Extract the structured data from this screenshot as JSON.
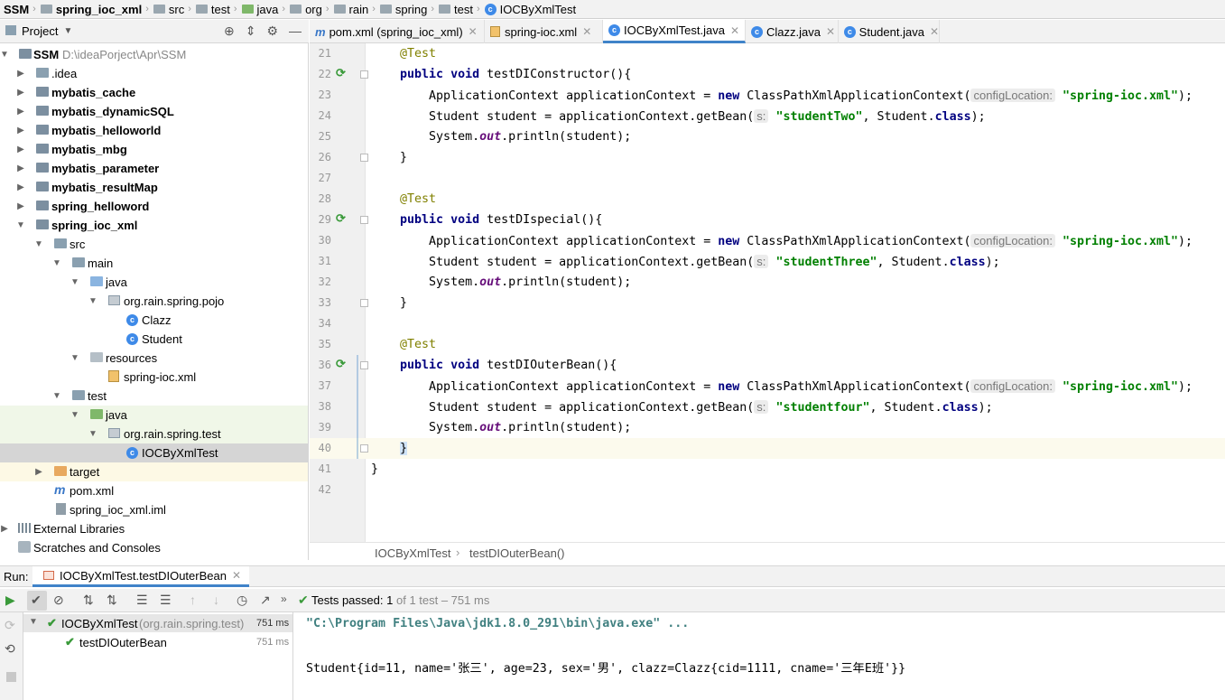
{
  "breadcrumb": [
    "SSM",
    "spring_ioc_xml",
    "src",
    "test",
    "java",
    "org",
    "rain",
    "spring",
    "test",
    "IOCByXmlTest"
  ],
  "project_panel": {
    "title": "Project",
    "tree": [
      {
        "label": "SSM",
        "extra": "D:\\ideaPorject\\Apr\\SSM",
        "bold": true
      },
      {
        "label": ".idea"
      },
      {
        "label": "mybatis_cache",
        "bold": true
      },
      {
        "label": "mybatis_dynamicSQL",
        "bold": true
      },
      {
        "label": "mybatis_helloworld",
        "bold": true
      },
      {
        "label": "mybatis_mbg",
        "bold": true
      },
      {
        "label": "mybatis_parameter",
        "bold": true
      },
      {
        "label": "mybatis_resultMap",
        "bold": true
      },
      {
        "label": "spring_helloword",
        "bold": true
      },
      {
        "label": "spring_ioc_xml",
        "bold": true
      },
      {
        "label": "src"
      },
      {
        "label": "main"
      },
      {
        "label": "java"
      },
      {
        "label": "org.rain.spring.pojo"
      },
      {
        "label": "Clazz"
      },
      {
        "label": "Student"
      },
      {
        "label": "resources"
      },
      {
        "label": "spring-ioc.xml"
      },
      {
        "label": "test"
      },
      {
        "label": "java"
      },
      {
        "label": "org.rain.spring.test"
      },
      {
        "label": "IOCByXmlTest"
      },
      {
        "label": "target"
      },
      {
        "label": "pom.xml"
      },
      {
        "label": "spring_ioc_xml.iml"
      },
      {
        "label": "External Libraries"
      },
      {
        "label": "Scratches and Consoles"
      }
    ]
  },
  "tabs": [
    {
      "label": "pom.xml (spring_ioc_xml)"
    },
    {
      "label": "spring-ioc.xml"
    },
    {
      "label": "IOCByXmlTest.java",
      "active": true
    },
    {
      "label": "Clazz.java"
    },
    {
      "label": "Student.java"
    }
  ],
  "editor": {
    "line_numbers": [
      "21",
      "22",
      "23",
      "24",
      "25",
      "26",
      "27",
      "28",
      "29",
      "30",
      "31",
      "32",
      "33",
      "34",
      "35",
      "36",
      "37",
      "38",
      "39",
      "40",
      "41",
      "42"
    ],
    "hint_config": "configLocation:",
    "hint_s": "s:",
    "annotation": "@Test",
    "kw_public": "public",
    "kw_void": "void",
    "kw_new": "new",
    "kw_class": "class",
    "kw_out": "out",
    "methods": [
      "testDIConstructor(){",
      "testDIspecial(){",
      "testDIOuterBean(){"
    ],
    "line_app_prefix": "ApplicationContext applicationContext = ",
    "line_app_call": " ClassPathXmlApplicationContext(",
    "str_xml": "\"spring-ioc.xml\"",
    "paren_end": ");",
    "line_student_prefix": "Student student = applicationContext.getBean(",
    "bean_names": [
      "\"studentTwo\"",
      "\"studentThree\"",
      "\"studentfour\""
    ],
    "student_class": ", Student.",
    "sysout_prefix": "System.",
    "sysout_suffix": ".println(student);",
    "close_brace": "}"
  },
  "editor_breadcrumb": [
    "IOCByXmlTest",
    "testDIOuterBean()"
  ],
  "run": {
    "label": "Run:",
    "tab": "IOCByXmlTest.testDIOuterBean",
    "status_prefix": "Tests passed:",
    "status_count": "1",
    "status_suffix": "of 1 test – 751 ms",
    "tests": [
      {
        "name": "IOCByXmlTest",
        "pkg": "(org.rain.spring.test)",
        "time": "751 ms"
      },
      {
        "name": "testDIOuterBean",
        "time": "751 ms"
      }
    ],
    "console": [
      "\"C:\\Program Files\\Java\\jdk1.8.0_291\\bin\\java.exe\" ...",
      "Student{id=11, name='张三', age=23, sex='男', clazz=Clazz{cid=1111, cname='三年E班'}}"
    ]
  },
  "colors": {
    "accent": "#4083c9",
    "pass": "#3a9a3a",
    "string": "#008000",
    "keyword": "#000080"
  }
}
